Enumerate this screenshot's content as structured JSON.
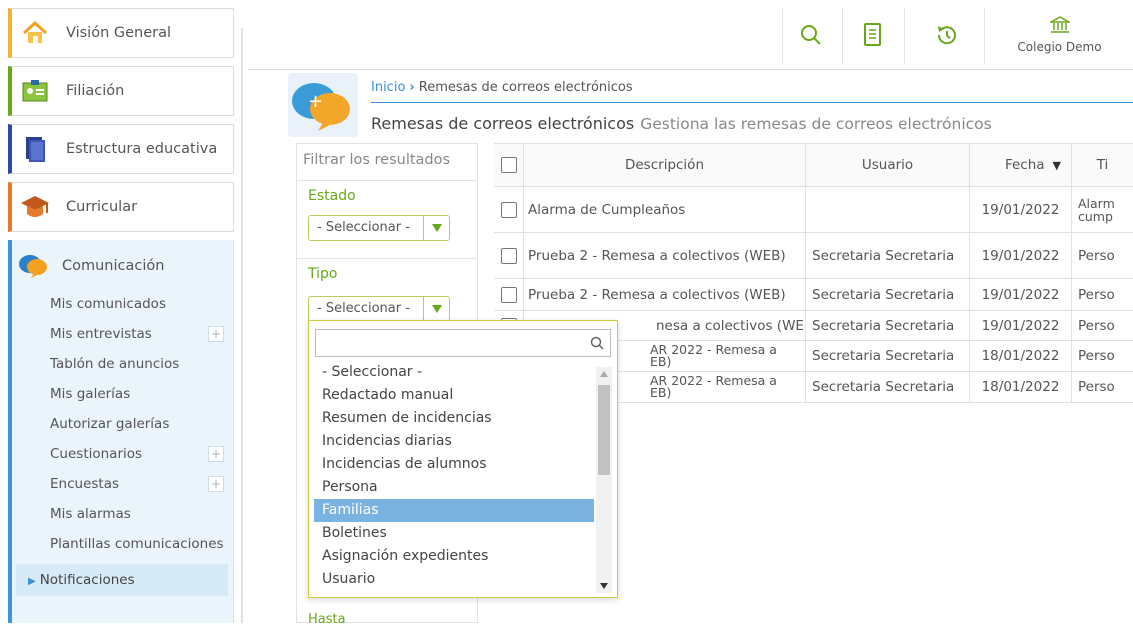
{
  "sidebar": {
    "modules": [
      {
        "label": "Visión General",
        "icon": "home-icon",
        "accent": "#f2b233"
      },
      {
        "label": "Filiación",
        "icon": "id-card-icon",
        "accent": "#6aa61a"
      },
      {
        "label": "Estructura educativa",
        "icon": "books-icon",
        "accent": "#2a4aa6"
      },
      {
        "label": "Curricular",
        "icon": "graduation-cap-icon",
        "accent": "#e8792c"
      },
      {
        "label": "Comunicación",
        "icon": "chat-bubbles-icon",
        "accent": "#3a97d6"
      }
    ],
    "comunicacion_items": [
      {
        "label": "Mis comunicados",
        "has_plus": false
      },
      {
        "label": "Mis entrevistas",
        "has_plus": true
      },
      {
        "label": "Tablón de anuncios",
        "has_plus": false
      },
      {
        "label": "Mis galerías",
        "has_plus": false
      },
      {
        "label": "Autorizar galerías",
        "has_plus": false
      },
      {
        "label": "Cuestionarios",
        "has_plus": true
      },
      {
        "label": "Encuestas",
        "has_plus": true
      },
      {
        "label": "Mis alarmas",
        "has_plus": false
      },
      {
        "label": "Plantillas comunicaciones",
        "has_plus": false
      }
    ],
    "plus_label": "+",
    "notificaciones": "Notificaciones",
    "notif_arrow": "▶"
  },
  "topbar": {
    "search_icon": "search-icon",
    "doc_icon": "document-icon",
    "history_icon": "history-icon",
    "school_name": "Colegio Demo",
    "school_icon": "institution-icon"
  },
  "breadcrumb": {
    "home": "Inicio",
    "separator": "›",
    "current": "Remesas de correos electrónicos"
  },
  "page": {
    "title": "Remesas de correos electrónicos",
    "description": "Gestiona las remesas de correos electrónicos"
  },
  "filters": {
    "search_placeholder": "Filtrar los resultados",
    "estado_label": "Estado",
    "estado_value": "- Seleccionar -",
    "tipo_label": "Tipo",
    "tipo_value": "- Seleccionar -",
    "hasta_label": "Hasta"
  },
  "table": {
    "headers": {
      "descripcion": "Descripción",
      "usuario": "Usuario",
      "fecha": "Fecha",
      "fecha_sort": "▼",
      "tipo": "Ti"
    },
    "rows": [
      {
        "descripcion": "Alarma de Cumpleaños",
        "usuario": "",
        "fecha": "19/01/2022",
        "tipo": "Alarm\ncump"
      },
      {
        "descripcion": "Prueba 2 - Remesa a colectivos (WEB)",
        "usuario": "Secretaria Secretaria",
        "fecha": "19/01/2022",
        "tipo": "Perso"
      },
      {
        "descripcion": "Prueba 2 - Remesa a colectivos (WEB)",
        "usuario": "Secretaria Secretaria",
        "fecha": "19/01/2022",
        "tipo": "Perso"
      },
      {
        "descripcion": "nesa a colectivos (WEB)",
        "usuario": "Secretaria Secretaria",
        "fecha": "19/01/2022",
        "tipo": "Perso"
      },
      {
        "descripcion": "AR 2022 - Remesa a\nEB)",
        "usuario": "Secretaria Secretaria",
        "fecha": "18/01/2022",
        "tipo": "Perso"
      },
      {
        "descripcion": "AR 2022 - Remesa a\nEB)",
        "usuario": "Secretaria Secretaria",
        "fecha": "18/01/2022",
        "tipo": "Perso"
      }
    ]
  },
  "dropdown": {
    "search_value": "",
    "search_icon": "search-icon",
    "options": [
      "- Seleccionar -",
      "Redactado manual",
      "Resumen de incidencias",
      "Incidencias diarias",
      "Incidencias de alumnos",
      "Persona",
      "Familias",
      "Boletines",
      "Asignación expedientes",
      "Usuario"
    ],
    "highlighted": "Familias"
  },
  "colors": {
    "accent_blue": "#3a8ed6",
    "accent_green": "#6aa61a",
    "highlight": "#7ab2e0"
  }
}
